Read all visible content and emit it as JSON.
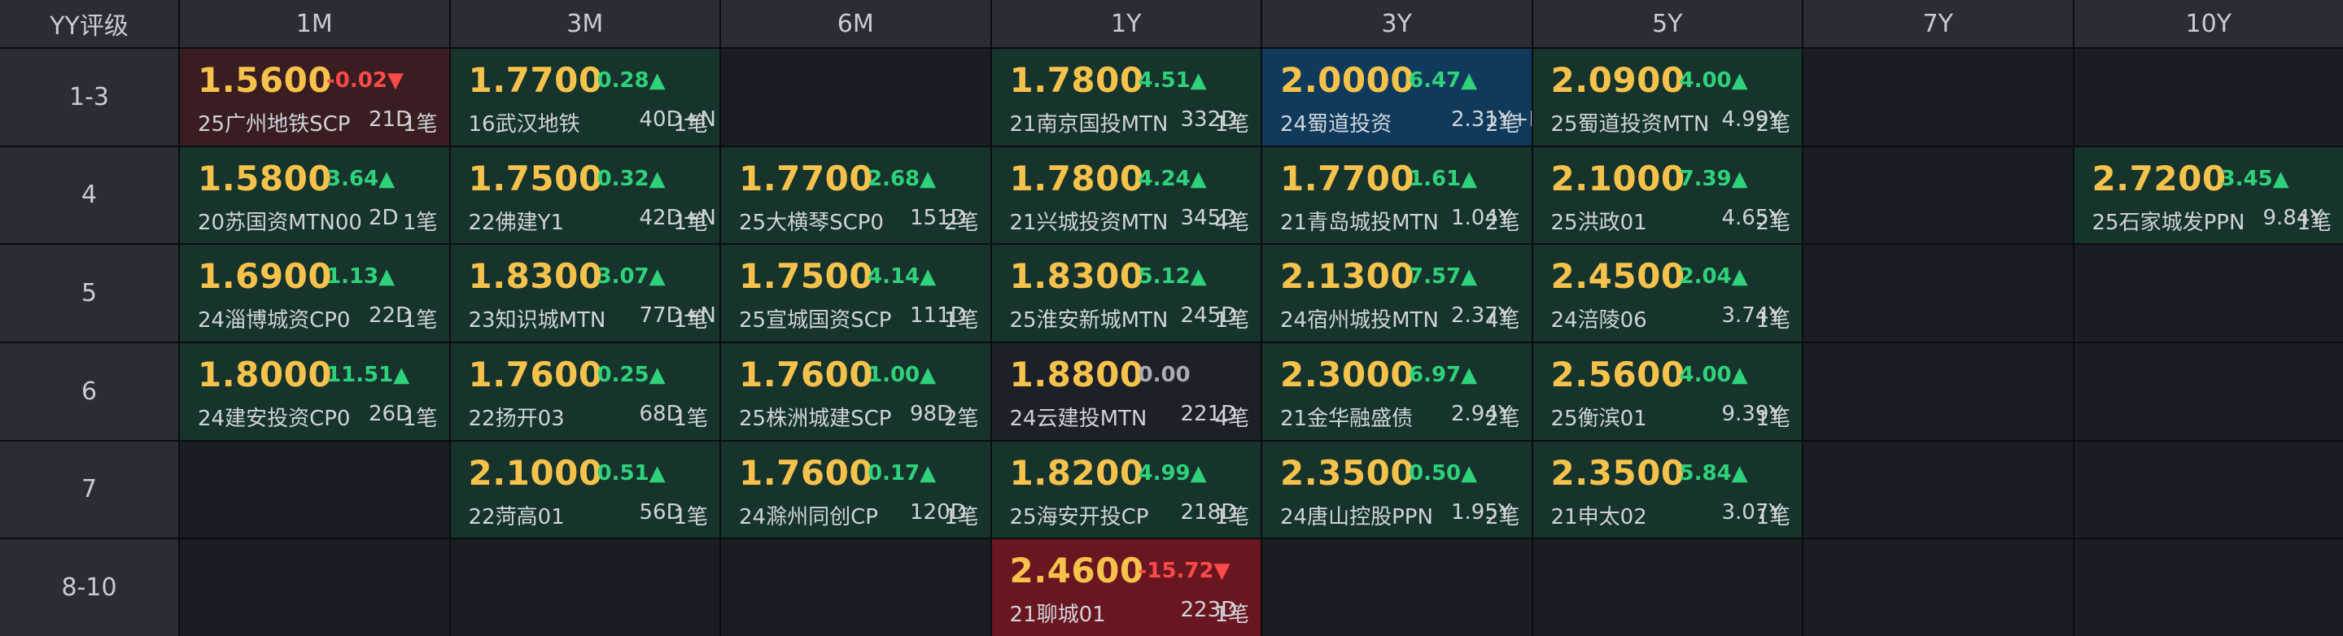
{
  "header": {
    "corner": "YY评级",
    "columns": [
      "1M",
      "3M",
      "6M",
      "1Y",
      "3Y",
      "5Y",
      "7Y",
      "10Y"
    ]
  },
  "rows": [
    {
      "label": "1-3",
      "cells": [
        {
          "color": "red-light",
          "price": "1.5600",
          "chg": "-0.02▼",
          "dir": "down",
          "name": "25广州地铁SCP",
          "term": "21D",
          "count": "1笔"
        },
        {
          "color": "green",
          "price": "1.7700",
          "chg": "0.28▲",
          "dir": "up",
          "name": "16武汉地铁",
          "term": "40D+N",
          "count": "1笔"
        },
        null,
        {
          "color": "green",
          "price": "1.7800",
          "chg": "4.51▲",
          "dir": "up",
          "name": "21南京国投MTN",
          "term": "332D",
          "count": "1笔"
        },
        {
          "color": "blue",
          "price": "2.0000",
          "chg": "6.47▲",
          "dir": "up",
          "name": "24蜀道投资",
          "term": "2.31Y+N",
          "count": "2笔"
        },
        {
          "color": "green",
          "price": "2.0900",
          "chg": "4.00▲",
          "dir": "up",
          "name": "25蜀道投资MTN",
          "term": "4.99Y",
          "count": "2笔"
        },
        null,
        null
      ]
    },
    {
      "label": "4",
      "cells": [
        {
          "color": "green",
          "price": "1.5800",
          "chg": "3.64▲",
          "dir": "up",
          "name": "20苏国资MTN00",
          "term": "2D",
          "count": "1笔"
        },
        {
          "color": "green",
          "price": "1.7500",
          "chg": "0.32▲",
          "dir": "up",
          "name": "22佛建Y1",
          "term": "42D+N",
          "count": "1笔"
        },
        {
          "color": "green",
          "price": "1.7700",
          "chg": "2.68▲",
          "dir": "up",
          "name": "25大横琴SCP0",
          "term": "151D",
          "count": "2笔"
        },
        {
          "color": "green",
          "price": "1.7800",
          "chg": "4.24▲",
          "dir": "up",
          "name": "21兴城投资MTN",
          "term": "345D",
          "count": "4笔"
        },
        {
          "color": "green",
          "price": "1.7700",
          "chg": "1.61▲",
          "dir": "up",
          "name": "21青岛城投MTN",
          "term": "1.04Y",
          "count": "2笔"
        },
        {
          "color": "green",
          "price": "2.1000",
          "chg": "7.39▲",
          "dir": "up",
          "name": "25洪政01",
          "term": "4.65Y",
          "count": "2笔"
        },
        null,
        {
          "color": "green",
          "price": "2.7200",
          "chg": "3.45▲",
          "dir": "up",
          "name": "25石家城发PPN",
          "term": "9.84Y",
          "count": "1笔"
        }
      ]
    },
    {
      "label": "5",
      "cells": [
        {
          "color": "green",
          "price": "1.6900",
          "chg": "1.13▲",
          "dir": "up",
          "name": "24淄博城资CP0",
          "term": "22D",
          "count": "1笔"
        },
        {
          "color": "green",
          "price": "1.8300",
          "chg": "3.07▲",
          "dir": "up",
          "name": "23知识城MTN",
          "term": "77D+N",
          "count": "1笔"
        },
        {
          "color": "green",
          "price": "1.7500",
          "chg": "4.14▲",
          "dir": "up",
          "name": "25宣城国资SCP",
          "term": "111D",
          "count": "1笔"
        },
        {
          "color": "green",
          "price": "1.8300",
          "chg": "5.12▲",
          "dir": "up",
          "name": "25淮安新城MTN",
          "term": "245D",
          "count": "1笔"
        },
        {
          "color": "green",
          "price": "2.1300",
          "chg": "7.57▲",
          "dir": "up",
          "name": "24宿州城投MTN",
          "term": "2.37Y",
          "count": "4笔"
        },
        {
          "color": "green",
          "price": "2.4500",
          "chg": "2.04▲",
          "dir": "up",
          "name": "24涪陵06",
          "term": "3.74Y",
          "count": "1笔"
        },
        null,
        null
      ]
    },
    {
      "label": "6",
      "cells": [
        {
          "color": "green",
          "price": "1.8000",
          "chg": "11.51▲",
          "dir": "up",
          "name": "24建安投资CP0",
          "term": "26D",
          "count": "1笔"
        },
        {
          "color": "green",
          "price": "1.7600",
          "chg": "0.25▲",
          "dir": "up",
          "name": "22扬开03",
          "term": "68D",
          "count": "1笔"
        },
        {
          "color": "green",
          "price": "1.7600",
          "chg": "1.00▲",
          "dir": "up",
          "name": "25株洲城建SCP",
          "term": "98D",
          "count": "2笔"
        },
        {
          "color": "dark",
          "price": "1.8800",
          "chg": "0.00",
          "dir": "flat",
          "name": "24云建投MTN",
          "term": "221D",
          "count": "4笔"
        },
        {
          "color": "green",
          "price": "2.3000",
          "chg": "6.97▲",
          "dir": "up",
          "name": "21金华融盛债",
          "term": "2.94Y",
          "count": "2笔"
        },
        {
          "color": "green",
          "price": "2.5600",
          "chg": "4.00▲",
          "dir": "up",
          "name": "25衡滨01",
          "term": "9.39Y",
          "count": "1笔"
        },
        null,
        null
      ]
    },
    {
      "label": "7",
      "cells": [
        null,
        {
          "color": "green",
          "price": "2.1000",
          "chg": "0.51▲",
          "dir": "up",
          "name": "22菏高01",
          "term": "56D",
          "count": "1笔"
        },
        {
          "color": "green",
          "price": "1.7600",
          "chg": "0.17▲",
          "dir": "up",
          "name": "24滁州同创CP",
          "term": "120D",
          "count": "1笔"
        },
        {
          "color": "green",
          "price": "1.8200",
          "chg": "4.99▲",
          "dir": "up",
          "name": "25海安开投CP",
          "term": "218D",
          "count": "1笔"
        },
        {
          "color": "green",
          "price": "2.3500",
          "chg": "0.50▲",
          "dir": "up",
          "name": "24唐山控股PPN",
          "term": "1.95Y",
          "count": "2笔"
        },
        {
          "color": "green",
          "price": "2.3500",
          "chg": "5.84▲",
          "dir": "up",
          "name": "21申太02",
          "term": "3.07Y",
          "count": "1笔"
        },
        null,
        null
      ]
    },
    {
      "label": "8-10",
      "cells": [
        null,
        null,
        null,
        {
          "color": "red",
          "price": "2.4600",
          "chg": "-15.72▼",
          "dir": "down",
          "name": "21聊城01",
          "term": "223D",
          "count": "1笔"
        },
        null,
        null,
        null,
        null
      ]
    }
  ]
}
